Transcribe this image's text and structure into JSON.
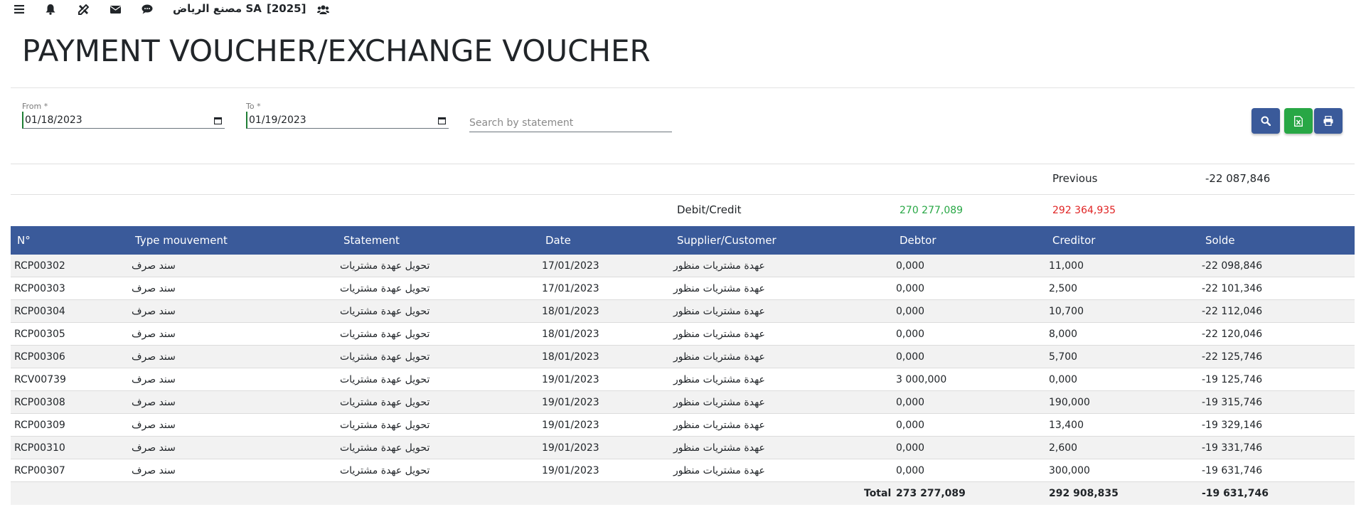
{
  "nav": {
    "icons": [
      "menu-icon",
      "bell-icon",
      "tools-icon",
      "envelope-icon",
      "chat-icon",
      "users-icon"
    ],
    "company": "مصنع الرياض SA",
    "year": "[2025]"
  },
  "page": {
    "title": "PAYMENT VOUCHER/EXCHANGE VOUCHER"
  },
  "filters": {
    "from_label": "From",
    "from_required": "*",
    "from_value": "01/18/2023",
    "to_label": "To",
    "to_required": "*",
    "to_value": "01/19/2023",
    "search_placeholder": "Search by statement"
  },
  "actions": {
    "search_icon": "search-icon",
    "excel_icon": "excel-icon",
    "print_icon": "print-icon"
  },
  "summary": {
    "previous_label": "Previous",
    "previous_value": "-22 087,846",
    "debit_credit_label": "Debit/Credit",
    "debit_value": "270 277,089",
    "credit_value": "292 364,935",
    "debit_color": "#28a745",
    "credit_color": "#e02424"
  },
  "table": {
    "headers": [
      "N°",
      "Type mouvement",
      "Statement",
      "Date",
      "Supplier/Customer",
      "Debtor",
      "Creditor",
      "Solde"
    ],
    "rows": [
      [
        "RCP00302",
        "سند صرف",
        "تحويل عهدة مشتريات",
        "17/01/2023",
        "عهدة مشتريات منظور",
        "0,000",
        "11,000",
        "-22 098,846"
      ],
      [
        "RCP00303",
        "سند صرف",
        "تحويل عهدة مشتريات",
        "17/01/2023",
        "عهدة مشتريات منظور",
        "0,000",
        "2,500",
        "-22 101,346"
      ],
      [
        "RCP00304",
        "سند صرف",
        "تحويل عهدة مشتريات",
        "18/01/2023",
        "عهدة مشتريات منظور",
        "0,000",
        "10,700",
        "-22 112,046"
      ],
      [
        "RCP00305",
        "سند صرف",
        "تحويل عهدة مشتريات",
        "18/01/2023",
        "عهدة مشتريات منظور",
        "0,000",
        "8,000",
        "-22 120,046"
      ],
      [
        "RCP00306",
        "سند صرف",
        "تحويل عهدة مشتريات",
        "18/01/2023",
        "عهدة مشتريات منظور",
        "0,000",
        "5,700",
        "-22 125,746"
      ],
      [
        "RCV00739",
        "سند صرف",
        "تحويل عهدة مشتريات",
        "19/01/2023",
        "عهدة مشتريات منظور",
        "3 000,000",
        "0,000",
        "-19 125,746"
      ],
      [
        "RCP00308",
        "سند صرف",
        "تحويل عهدة مشتريات",
        "19/01/2023",
        "عهدة مشتريات منظور",
        "0,000",
        "190,000",
        "-19 315,746"
      ],
      [
        "RCP00309",
        "سند صرف",
        "تحويل عهدة مشتريات",
        "19/01/2023",
        "عهدة مشتريات منظور",
        "0,000",
        "13,400",
        "-19 329,146"
      ],
      [
        "RCP00310",
        "سند صرف",
        "تحويل عهدة مشتريات",
        "19/01/2023",
        "عهدة مشتريات منظور",
        "0,000",
        "2,600",
        "-19 331,746"
      ],
      [
        "RCP00307",
        "سند صرف",
        "تحويل عهدة مشتريات",
        "19/01/2023",
        "عهدة مشتريات منظور",
        "0,000",
        "300,000",
        "-19 631,746"
      ]
    ],
    "total_label": "Total",
    "total_debtor": "273 277,089",
    "total_creditor": "292 908,835",
    "total_solde": "-19 631,746"
  }
}
